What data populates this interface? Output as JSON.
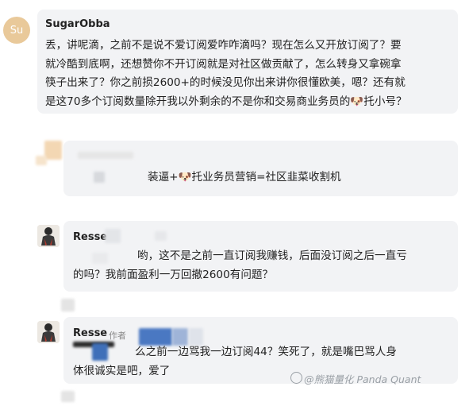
{
  "comments": [
    {
      "avatar_initials": "Su",
      "author": "SugarObba",
      "lines": [
        "丢，讲呢滴，之前不是说不爱订阅爱咋咋滴吗？现在怎么又开放订阅了？要",
        "就冷酷到底啊，还想赞你不开订阅就是对社区做贡献了，怎么转身又拿碗拿",
        "筷子出来了？你之前损2600+的时候没见你出来讲你很懂欧美，嗯？还有就",
        "是这70多个订阅数量除开我以外剩余的不是你和交易商业务员的🐶托小号？"
      ]
    },
    {
      "text": "装逼+🐶托业务员营销=社区韭菜收割机"
    },
    {
      "author": "Resse",
      "lines": [
        "哟，这不是之前一直订阅我赚钱，后面没订阅之后一直亏",
        "的吗？我前面盈利一万回撤2600有问题？"
      ]
    },
    {
      "author": "Resse",
      "author_tag": "作者",
      "lines": [
        "么之前一边骂我一边订阅44？笑死了，就是嘴巴骂人身",
        "体很诚实是吧，爱了"
      ]
    }
  ],
  "watermark": "@熊猫量化 Panda Quant",
  "colors": {
    "bubble": "#f2f3f5",
    "avatar_su": "#e9c99a",
    "text": "#222222",
    "muted": "#888888"
  }
}
